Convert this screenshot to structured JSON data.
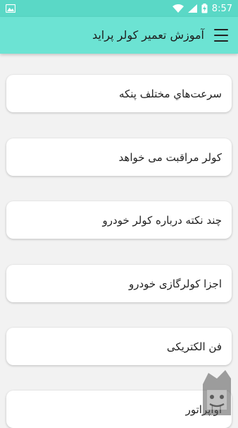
{
  "status_bar": {
    "time": "8:57",
    "icons": [
      "image-icon",
      "wifi-icon",
      "signal-icon",
      "battery-charging-icon"
    ]
  },
  "app_bar": {
    "title": "آموزش تعمیر کولر پراید",
    "menu_icon": "hamburger-menu-icon"
  },
  "items": [
    {
      "label": "سرعت‌هاي مختلف پنكه"
    },
    {
      "label": "کولر مراقبت می خواهد"
    },
    {
      "label": "چند نكته درباره كولر خودرو"
    },
    {
      "label": "اجزا كولرگازی خودرو"
    },
    {
      "label": "فن الكتريكی"
    },
    {
      "label": "اواپراتور"
    }
  ],
  "colors": {
    "status_bar": "#5ad8c6",
    "app_bar": "#6ce3d3",
    "background": "#f2f2f2",
    "card": "#ffffff"
  },
  "watermark": {
    "icon": "store-logo-icon"
  }
}
